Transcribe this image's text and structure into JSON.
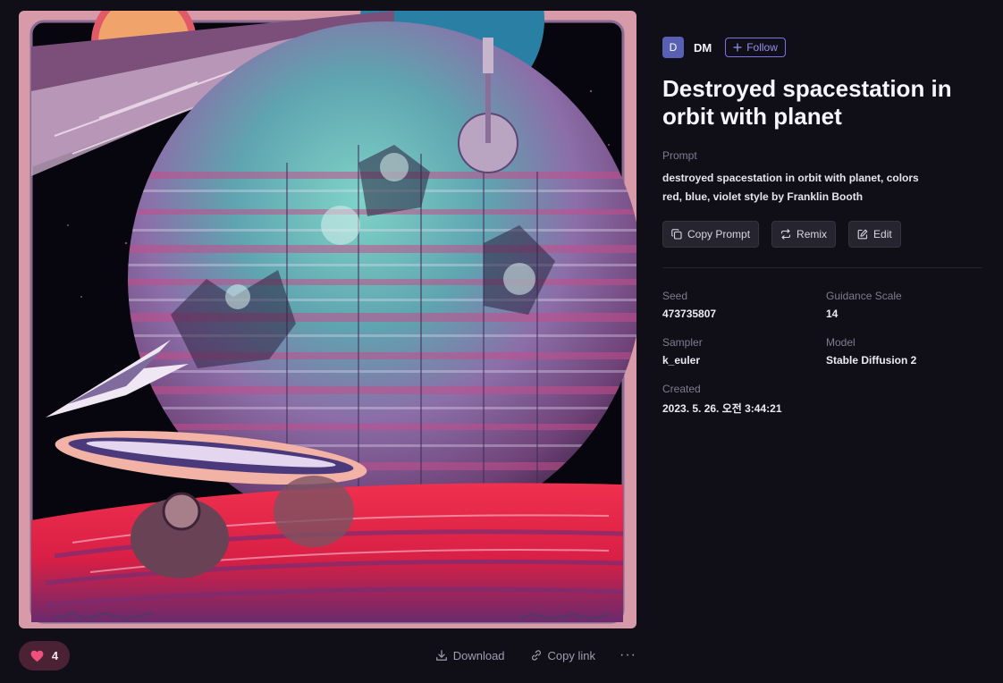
{
  "artwork": {
    "alt": "Destroyed spacestation in orbit with planet"
  },
  "author": {
    "avatar_letter": "D",
    "name": "DM",
    "follow_label": "Follow",
    "avatar_color": "#5860b4"
  },
  "title": "Destroyed spacestation in orbit with planet",
  "prompt": {
    "label": "Prompt",
    "text": "destroyed spacestation in orbit with planet, colors red, blue, violet style by Franklin Booth"
  },
  "buttons": {
    "copy_prompt": "Copy Prompt",
    "remix": "Remix",
    "edit": "Edit"
  },
  "meta": {
    "seed_label": "Seed",
    "seed_value": "473735807",
    "guidance_label": "Guidance Scale",
    "guidance_value": "14",
    "sampler_label": "Sampler",
    "sampler_value": "k_euler",
    "model_label": "Model",
    "model_value": "Stable Diffusion 2",
    "created_label": "Created",
    "created_value": "2023. 5. 26. 오전 3:44:21"
  },
  "actions": {
    "like_count": "4",
    "download_label": "Download",
    "copy_link_label": "Copy link",
    "more_label": "···"
  },
  "colors": {
    "background": "#100f17",
    "accent": "#7b72e8",
    "like_pill": "#4a2233",
    "heart": "#f0507d"
  }
}
